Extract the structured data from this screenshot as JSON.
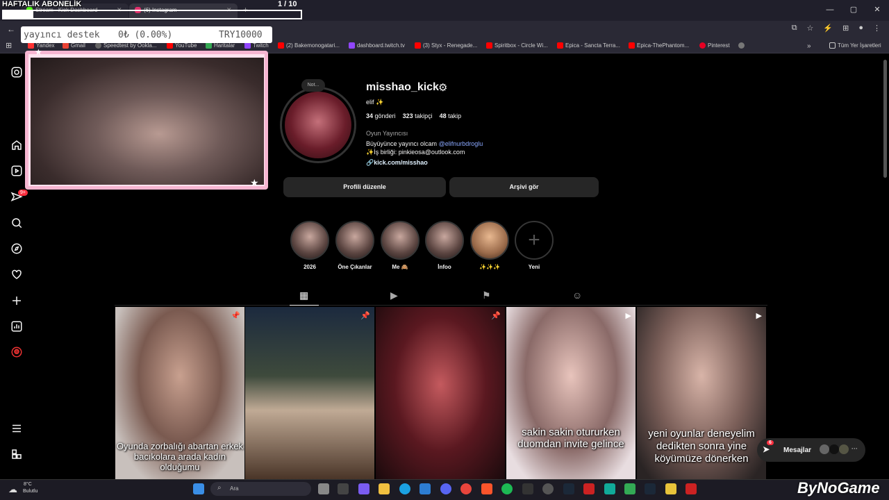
{
  "overlay": {
    "title": "HAFTALIK ABONELİK",
    "counter": "1 / 10",
    "progress_fraction": 0.1,
    "donate_label": "yayıncı destek",
    "donate_amount": "0₺ (0.00%)",
    "donate_goal": "TRY10000"
  },
  "browser": {
    "tabs": [
      {
        "label": "Stream - Kick Dashboard",
        "active": false
      },
      {
        "label": "(6) Instagram",
        "active": true
      }
    ],
    "bookmarks": [
      "Yandex",
      "Gmail",
      "Speedtest by Ookla...",
      "YouTube",
      "Haritalar",
      "Twitch",
      "(2) Bakemonogatari...",
      "dashboard.twitch.tv",
      "(3) Styx - Renegade...",
      "Spiritbox - Circle Wi...",
      "Epica - Sancta Terra...",
      "Epica-ThePhantom...",
      "Pinterest"
    ],
    "all_bookmarks": "Tüm Yer İşaretleri"
  },
  "sidebar": {
    "notification_badge": "9+",
    "icons": [
      "instagram-icon",
      "home-icon",
      "reels-icon",
      "messages-icon",
      "search-icon",
      "explore-icon",
      "heart-icon",
      "create-icon",
      "dashboard-icon",
      "profile-icon",
      "menu-icon",
      "also-from-meta-icon"
    ]
  },
  "profile": {
    "note": "Not...",
    "username": "misshao_kick",
    "full_name": "elif ✨",
    "posts_count": "34",
    "posts_label": "gönderi",
    "followers_count": "323",
    "followers_label": "takipçi",
    "following_count": "48",
    "following_label": "takip",
    "category": "Oyun Yayıncısı",
    "bio_line1": "Büyüyünce yayıncı olcam",
    "bio_mention": "@elifnurbdroglu",
    "bio_line2": "✨İş birliği: pinkieosa@outlook.com",
    "link": "kick.com/misshao",
    "edit_button": "Profili düzenle",
    "archive_button": "Arşivi gör"
  },
  "highlights": [
    {
      "label": "2026"
    },
    {
      "label": "Öne Çıkanlar"
    },
    {
      "label": "Me 🙈"
    },
    {
      "label": "İnfoo"
    },
    {
      "label": "✨✨✨"
    },
    {
      "label": "Yeni"
    }
  ],
  "posts": [
    {
      "caption": "Oyunda zorbalığı abartan erkek bacıkolara arada kadın olduğumu",
      "pinned": true,
      "reel": false
    },
    {
      "caption": "",
      "pinned": true,
      "reel": false
    },
    {
      "caption": "",
      "pinned": true,
      "reel": false
    },
    {
      "caption": "sakin sakin otururken duomdan invite gelince",
      "pinned": false,
      "reel": true
    },
    {
      "caption": "yeni oyunlar deneyelim dedikten sonra yine köyümüze dönerken",
      "pinned": false,
      "reel": true
    }
  ],
  "messages": {
    "label": "Mesajlar",
    "badge": "6"
  },
  "taskbar": {
    "temperature": "8°C",
    "weather": "Bulutlu",
    "search_placeholder": "Ara",
    "watermark": "ByNoGame"
  }
}
